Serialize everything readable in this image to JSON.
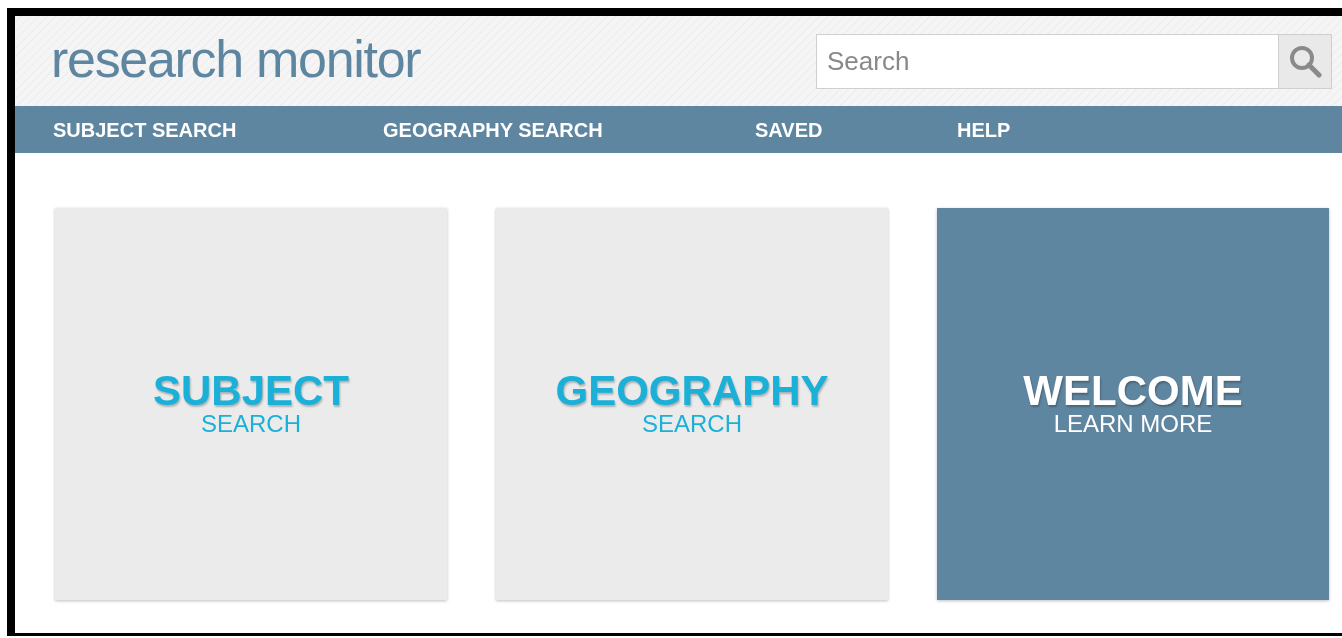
{
  "logo": "research monitor",
  "search": {
    "placeholder": "Search"
  },
  "nav": [
    "SUBJECT SEARCH",
    "GEOGRAPHY SEARCH",
    "SAVED",
    "HELP"
  ],
  "tiles": [
    {
      "kind": "light",
      "title": "SUBJECT",
      "subtitle": "SEARCH"
    },
    {
      "kind": "light",
      "title": "GEOGRAPHY",
      "subtitle": "SEARCH"
    },
    {
      "kind": "dark",
      "title": "WELCOME",
      "subtitle": "LEARN MORE"
    }
  ]
}
